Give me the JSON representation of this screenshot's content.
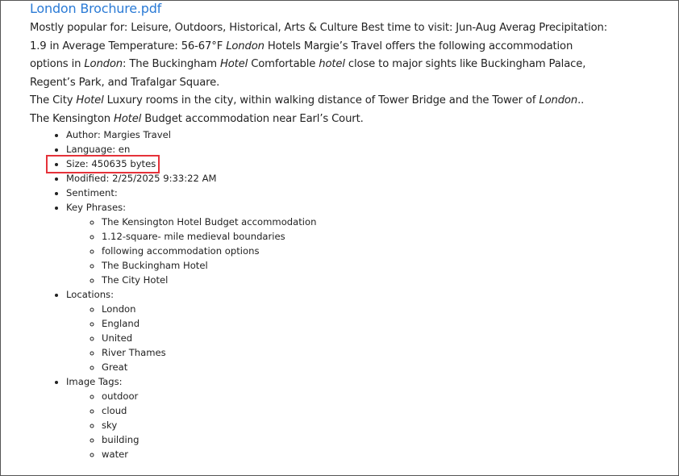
{
  "title": "London Brochure.pdf",
  "paragraph_lines": [
    [
      {
        "t": "Mostly popular for: Leisure, Outdoors, Historical, Arts & Culture Best time to visit: Jun-Aug Averag Precipitation:",
        "i": false
      }
    ],
    [
      {
        "t": "1.9 in Average Temperature: 56-67°F ",
        "i": false
      },
      {
        "t": "London",
        "i": true
      },
      {
        "t": " Hotels Margie’s Travel offers the following accommodation",
        "i": false
      }
    ],
    [
      {
        "t": "options in ",
        "i": false
      },
      {
        "t": "London",
        "i": true
      },
      {
        "t": ": The Buckingham ",
        "i": false
      },
      {
        "t": "Hotel",
        "i": true
      },
      {
        "t": " Comfortable ",
        "i": false
      },
      {
        "t": "hotel",
        "i": true
      },
      {
        "t": " close to major sights like Buckingham Palace,",
        "i": false
      }
    ],
    [
      {
        "t": "Regent’s Park, and Trafalgar Square.",
        "i": false
      }
    ],
    [
      {
        "t": "The City ",
        "i": false
      },
      {
        "t": "Hotel",
        "i": true
      },
      {
        "t": " Luxury rooms in the city, within walking distance of Tower Bridge and the Tower of ",
        "i": false
      },
      {
        "t": "London",
        "i": true
      },
      {
        "t": "..",
        "i": false
      }
    ],
    [
      {
        "t": "The Kensington ",
        "i": false
      },
      {
        "t": "Hotel",
        "i": true
      },
      {
        "t": " Budget accommodation near Earl’s Court.",
        "i": false
      }
    ]
  ],
  "details": {
    "author": "Author: Margies Travel",
    "language": "Language: en",
    "size": "Size: 450635 bytes",
    "modified": "Modified: 2/25/2025 9:33:22 AM",
    "sentiment": "Sentiment:",
    "key_phrases_label": "Key Phrases:",
    "key_phrases": [
      "The Kensington Hotel Budget accommodation",
      "1.12-square- mile medieval boundaries",
      "following accommodation options",
      "The Buckingham Hotel",
      "The City Hotel"
    ],
    "locations_label": "Locations:",
    "locations": [
      "London",
      "England",
      "United",
      "River Thames",
      "Great"
    ],
    "image_tags_label": "Image Tags:",
    "image_tags": [
      "outdoor",
      "cloud",
      "sky",
      "building",
      "water"
    ]
  },
  "highlight_color": "#e5323a",
  "link_color": "#2b7bd6"
}
